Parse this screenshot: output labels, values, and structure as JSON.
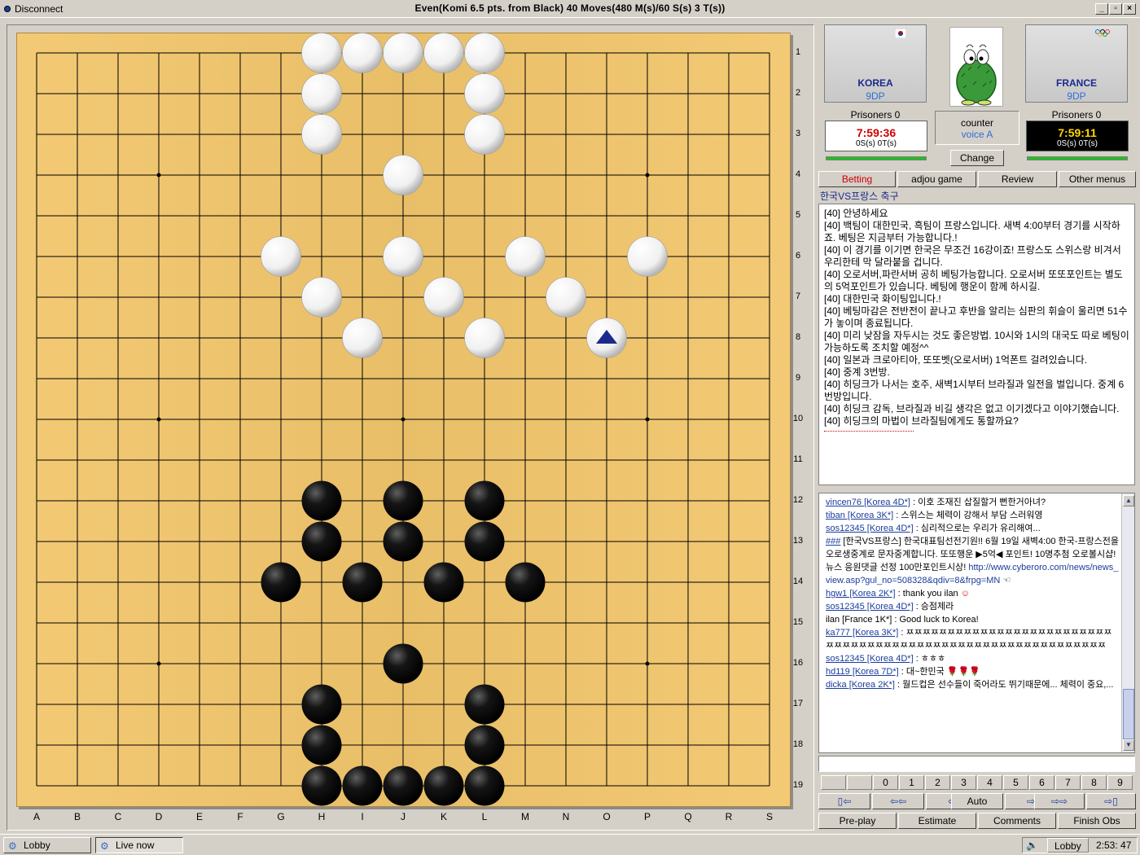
{
  "window": {
    "disconnect_label": "Disconnect",
    "title": "Even(Komi 6.5 pts. from Black) 40  Moves(480 M(s)/60 S(s) 3 T(s))"
  },
  "board": {
    "columns": [
      "A",
      "B",
      "C",
      "D",
      "E",
      "F",
      "G",
      "H",
      "I",
      "J",
      "K",
      "L",
      "M",
      "N",
      "O",
      "P",
      "Q",
      "R",
      "S"
    ],
    "rows": [
      "1",
      "2",
      "3",
      "4",
      "5",
      "6",
      "7",
      "8",
      "9",
      "10",
      "11",
      "12",
      "13",
      "14",
      "15",
      "16",
      "17",
      "18",
      "19"
    ],
    "white_stones": [
      "H1",
      "I1",
      "J1",
      "K1",
      "L1",
      "H2",
      "L2",
      "H3",
      "L3",
      "J4",
      "G6",
      "J6",
      "M6",
      "P6",
      "H7",
      "K7",
      "N7",
      "I8",
      "L8",
      "O8"
    ],
    "black_stones": [
      "H12",
      "J12",
      "L12",
      "H13",
      "J13",
      "L13",
      "G14",
      "I14",
      "K14",
      "M14",
      "J16",
      "H17",
      "L17",
      "H18",
      "L18",
      "H19",
      "I19",
      "J19",
      "K19",
      "L19"
    ],
    "last_move": "O8",
    "colors": {
      "board": "#f2c66c",
      "line": "#000000",
      "last_move_marker": "#1a2a8c"
    }
  },
  "players": {
    "left": {
      "country": "KOREA",
      "rank": "9DP",
      "prisoners": "Prisoners  0",
      "time": "7:59:36",
      "period": "0S(s) 0T(s)"
    },
    "right": {
      "country": "FRANCE",
      "rank": "9DP",
      "prisoners": "Prisoners  0",
      "time": "7:59:11",
      "period": "0S(s) 0T(s)"
    },
    "center": {
      "label": "counter",
      "voice": "voice A",
      "change_label": "Change"
    }
  },
  "menu": {
    "betting": "Betting",
    "adjou": "adjou game",
    "review": "Review",
    "other": "Other menus"
  },
  "room_title": "한국VS프랑스 축구",
  "notice_lines": [
    "[40] 안녕하세요",
    "[40] 백팀이 대한민국, 흑팀이 프랑스입니다. 새벽 4:00부터 경기를 시작하죠. 베팅은 지금부터 가능합니다.!",
    "[40] 이 경기를 이기면 한국은 무조건 16강이죠! 프랑스도 스위스랑 비겨서 우리한테 막 달라붙을 겁니다.",
    "[40] 오로서버,파란서버 공히 베팅가능합니다. 오로서버 또또포인트는 별도의 5억포인트가 있습니다. 베팅에 행운이 함께 하시길.",
    "[40] 대한민국 화이팅입니다.!",
    "[40] 베팅마감은 전반전이 끝나고 후반을 알리는 심판의 휘슬이 울리면 51수가 놓이며 종료됩니다.",
    "[40] 미리 낮잠을 자두시는 것도 좋은방법. 10시와 1시의 대국도 따로 베팅이 가능하도록 조치할 예정^^",
    "[40] 일본과 크로아티아, 또또벳(오로서버) 1억폰트 걸려있습니다.",
    "[40] 중계 3번방.",
    "[40] 히딩크가 나서는 호주, 새벽1시부터 브라질과 일전을 벌입니다. 중계 6번방입니다.",
    "[40] 히딩크 감독, 브라질과 비길 생각은 없고 이기겠다고 이야기했습니다.",
    "[40] 히딩크의 마법이 브라질팀에게도 통할까요?"
  ],
  "chat": [
    {
      "user": "vincen76 [Korea 4D*]",
      "text": " : 이호 조재진 삽질할거 뻔한거아녀?"
    },
    {
      "user": "tiban [Korea 3K*]",
      "text": " : 스위스는 체력이 강해서 부담 스러워영"
    },
    {
      "user": "sos12345 [Korea 4D*]",
      "text": " : 심리적으로는 우리가 유리해여..."
    },
    {
      "user": "###",
      "text": " [한국VS프랑스] 한국대표팀선전기원!! 6월 19일 새벽4:00 한국-프랑스전을 오로생중계로 문자중계합니다. 또또행운 ▶5억◀ 포인트! 10명추첨 오로볼시샵! 뉴스 응원댓글 선정 100만포인트시상!",
      "link": "http://www.cyberoro.com/news/news_view.asp?gul_no=508328&qdiv=8&frpg=MN",
      "after": " ☜"
    },
    {
      "user": "hgw1 [Korea 2K*]",
      "text": " : thank you ilan",
      "emoji": "☺"
    },
    {
      "user": "sos12345 [Korea 4D*]",
      "text": " : 승점제라"
    },
    {
      "plain": "ilan [France 1K*] : Good luck to Korea!"
    },
    {
      "user": "ka777 [Korea 3K*]",
      "text": " : ㅉㅉㅉㅉㅉㅉㅉㅉㅉㅉㅉㅉㅉㅉㅉㅉㅉㅉㅉㅉㅉㅉㅉㅉㅉㅉㅉㅉㅉㅉㅉㅉㅉㅉㅉㅉㅉㅉㅉㅉㅉㅉㅉㅉㅉㅉㅉㅉㅉㅉㅉㅉㅉㅉㅉㅉㅉㅉㅉ"
    },
    {
      "user": "sos12345 [Korea 4D*]",
      "text": " : ㅎㅎㅎ"
    },
    {
      "user": "hd119 [Korea 7D*]",
      "text": " : 대~한민국",
      "emoji": "🌹🌹🌹"
    },
    {
      "user": "dicka [Korea 2K*]",
      "text": " : 월드컵은 선수들이 죽어라도 뛰기때문에... 체력이 중요,..."
    }
  ],
  "move_numbers": [
    "0",
    "1",
    "2",
    "3",
    "4",
    "5",
    "6",
    "7",
    "8",
    "9"
  ],
  "nav": {
    "first": "▯⇦",
    "back10": "⇦⇦",
    "back": "⇦",
    "auto": "Auto",
    "fwd": "⇨",
    "fwd10": "⇨⇨",
    "last": "⇨▯"
  },
  "actions": {
    "preplay": "Pre-play",
    "estimate": "Estimate",
    "comments": "Comments",
    "finish": "Finish Obs"
  },
  "taskbar": {
    "lobby": "Lobby",
    "live": "Live now",
    "tray_lobby": "Lobby",
    "clock": "2:53:  47"
  }
}
